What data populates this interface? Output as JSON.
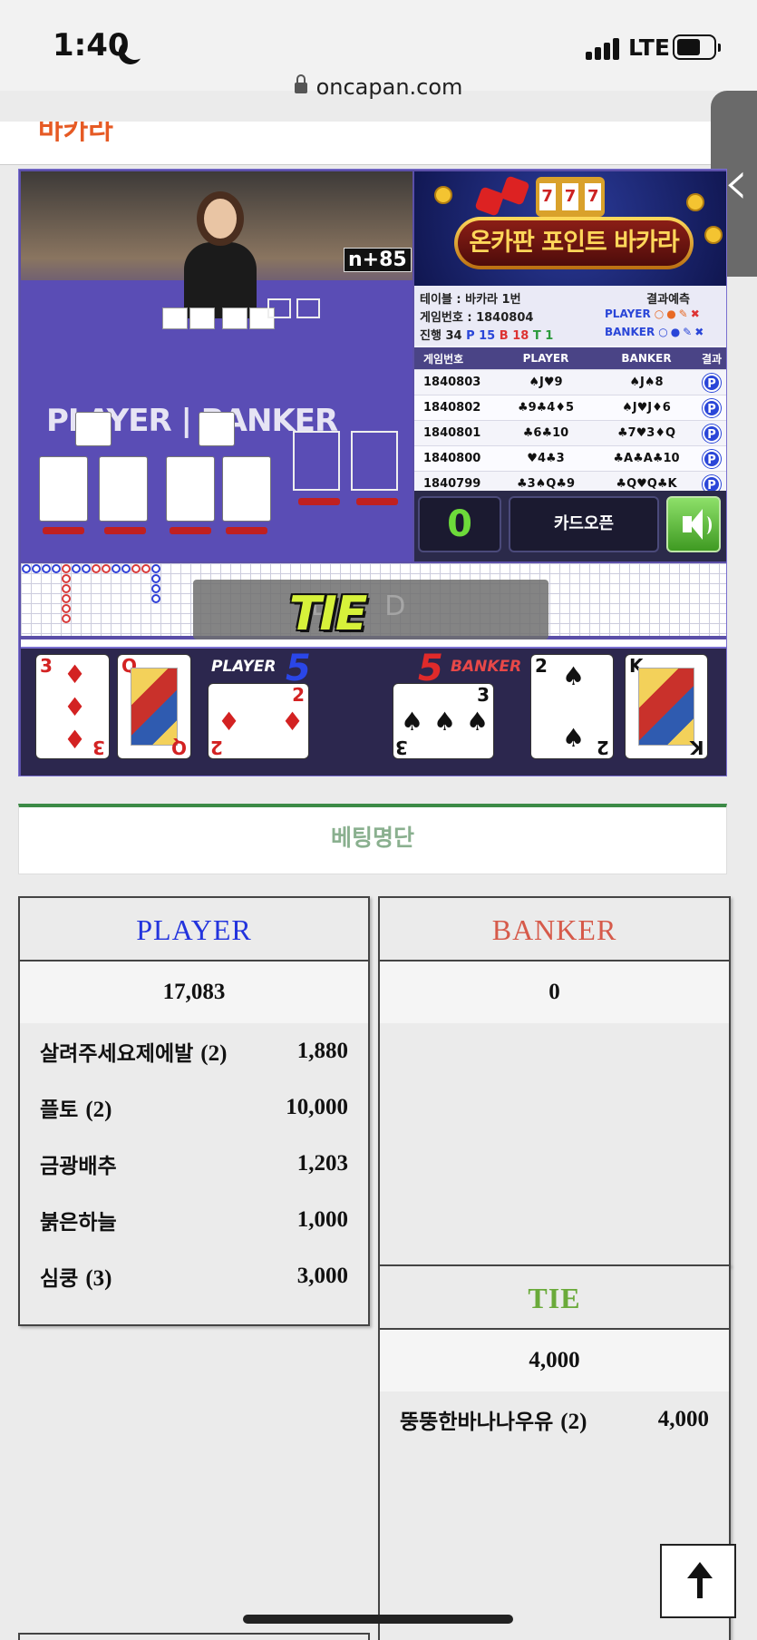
{
  "status_bar": {
    "time": "1:40",
    "network": "LTE",
    "battery_level": 0.65
  },
  "browser": {
    "url": "oncapan.com",
    "page_header_partial": "바카라"
  },
  "game": {
    "camera_counter": "n+85",
    "table_labels": {
      "player": "PLAYER",
      "banker": "BANKER"
    },
    "banner_title": "온카판 포인트 바카라",
    "slot_digits": [
      "7",
      "7",
      "7"
    ],
    "info": {
      "table": "테이블 : 바카라 1번",
      "game_no": "게임번호 : 1840804",
      "progress_label": "진행 34",
      "p_count": "P 15",
      "b_count": "B 18",
      "t_count": "T 1",
      "predict_label": "결과예측",
      "predict_player": "PLAYER",
      "predict_banker": "BANKER"
    },
    "history": {
      "headers": [
        "게임번호",
        "PLAYER",
        "BANKER",
        "결과"
      ],
      "rows": [
        {
          "no": "1840803",
          "player": "♠J♥9",
          "banker": "♠J♠8",
          "result": "P"
        },
        {
          "no": "1840802",
          "player": "♣9♣4♦5",
          "banker": "♠J♥J♦6",
          "result": "P"
        },
        {
          "no": "1840801",
          "player": "♣6♣10",
          "banker": "♣7♥3♦Q",
          "result": "P"
        },
        {
          "no": "1840800",
          "player": "♥4♣3",
          "banker": "♣A♣A♣10",
          "result": "P"
        },
        {
          "no": "1840799",
          "player": "♣3♠Q♣9",
          "banker": "♣Q♥Q♣K",
          "result": "P"
        }
      ]
    },
    "countdown": "0",
    "card_open_label": "카드오픈",
    "result_banner": "TIE",
    "player_score": "5",
    "banker_score": "5",
    "player_label": "PLAYER",
    "banker_label": "BANKER",
    "player_cards": [
      {
        "rank": "3",
        "suit": "♦",
        "color": "red"
      },
      {
        "rank": "Q",
        "suit": "♥",
        "color": "red",
        "face": true
      },
      {
        "rank": "2",
        "suit": "♦",
        "color": "red",
        "rotated": true
      }
    ],
    "banker_cards": [
      {
        "rank": "3",
        "suit": "♠",
        "color": "black",
        "rotated": true
      },
      {
        "rank": "2",
        "suit": "♠",
        "color": "black"
      },
      {
        "rank": "K",
        "suit": "♣",
        "color": "black",
        "face": true
      }
    ]
  },
  "betting": {
    "title": "베팅명단",
    "player": {
      "header": "PLAYER",
      "total": "17,083",
      "bettors": [
        {
          "name": "살려주세요제에발",
          "count": "(2)",
          "amount": "1,880"
        },
        {
          "name": "플토",
          "count": "(2)",
          "amount": "10,000"
        },
        {
          "name": "금광배추",
          "count": "",
          "amount": "1,203"
        },
        {
          "name": "붉은하늘",
          "count": "",
          "amount": "1,000"
        },
        {
          "name": "심쿵",
          "count": "(3)",
          "amount": "3,000"
        }
      ]
    },
    "banker": {
      "header": "BANKER",
      "total": "0"
    },
    "tie": {
      "header": "TIE",
      "total": "4,000",
      "bettors": [
        {
          "name": "뚱뚱한바나나우유",
          "count": "(2)",
          "amount": "4,000"
        }
      ]
    }
  },
  "colors": {
    "player": "#2233dd",
    "banker": "#d65a4a",
    "tie": "#6aaa3a",
    "accent_green": "#3c8a46"
  }
}
